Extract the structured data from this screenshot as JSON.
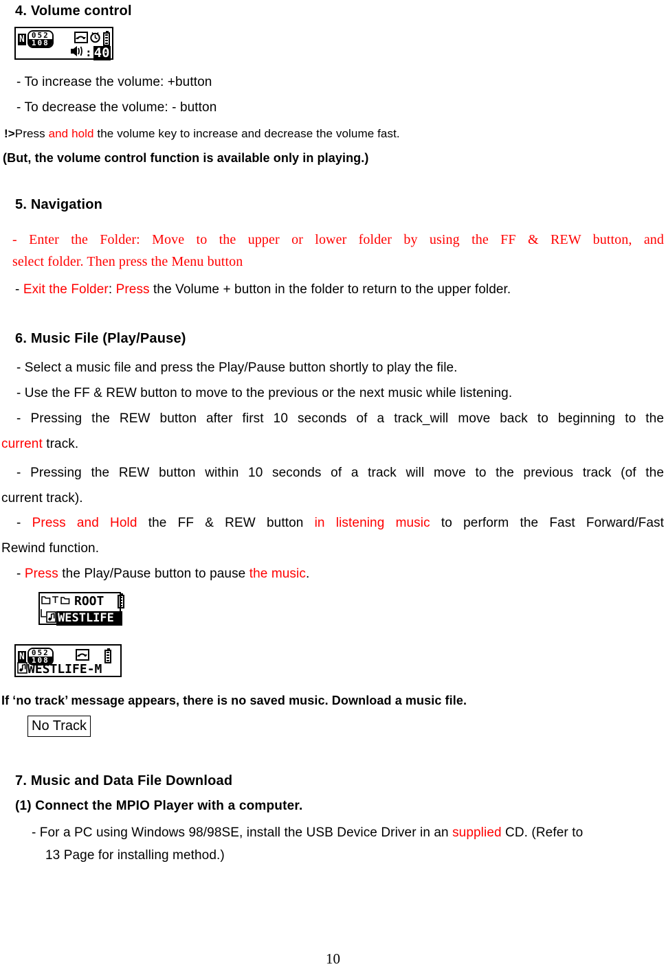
{
  "document": {
    "page_number": "10"
  },
  "sections": {
    "volume": {
      "heading": "4. Volume control",
      "bullet_increase": "-  To increase the volume: +button",
      "bullet_decrease": "-  To decrease the volume: - button",
      "note_prefix": "!>",
      "note_a": "Press ",
      "note_highlight": "and hold",
      "note_b": " the volume key to increase and decrease the volume fast.",
      "note_paren": "(But, the volume control function is available only in playing.)",
      "lcd": {
        "name": "volume-lcd",
        "indicator_letter": "N",
        "track_current": "052",
        "track_total": "108",
        "icon_repeat": "repeat-folder-icon",
        "icon_clock": "clock-icon",
        "icon_battery": "battery-icon",
        "volume_label": ":",
        "volume_value": "40"
      }
    },
    "navigation": {
      "heading": "5. Navigation",
      "enter_line1": "-  Enter the Folder: Move to the upper or lower folder by using the FF & REW button, and",
      "enter_line2": "select folder. Then press the Menu button",
      "exit_dash": "-  ",
      "exit_red1": "Exit the Folder",
      "exit_black1": ": ",
      "exit_red2": "Press",
      "exit_black2": " the Volume + button in the folder to return to the upper folder."
    },
    "musicfile": {
      "heading": "6. Music File (Play/Pause)",
      "b1": "-  Select a music file and press the Play/Pause button shortly to play the file.",
      "b2": "-  Use the FF & REW button to move to the previous or the next music while listening.",
      "b3_line1": "-  Pressing the REW button after first 10 seconds of a track_will move back to beginning to the",
      "b3_line2_red": "current",
      "b3_line2_black": " track.",
      "b4_line1": "-  Pressing the REW button within 10 seconds of a track will move to the previous track (of the",
      "b4_line2": "current track).",
      "b5_dash": "-  ",
      "b5_red1": "Press and Hold",
      "b5_black1": " the FF & REW button ",
      "b5_red2": "in listening music",
      "b5_black2": " to perform the Fast Forward/Fast",
      "b5_line2": "Rewind function.",
      "b6_dash": "-  ",
      "b6_red1": "Press",
      "b6_black1": " the Play/Pause button to pause ",
      "b6_red2": "the music",
      "b6_black2": ".",
      "lcd_root": {
        "name": "folder-browse-lcd",
        "icon_folder": "folder-icon",
        "icon_tree": "tree-branch-icon",
        "icon_subfolder": "subfolder-icon",
        "title": "ROOT",
        "icon_battery": "battery-icon",
        "icon_music_file": "music-file-icon",
        "selected_item": "WESTLIFE"
      },
      "lcd_playing": {
        "name": "now-playing-lcd",
        "indicator_letter": "N",
        "track_current": "052",
        "track_total": "108",
        "icon_repeat": "repeat-folder-icon",
        "icon_battery": "battery-icon",
        "icon_music_file": "music-file-icon",
        "track_title": "WESTLIFE-M"
      },
      "notrack_text": "If ‘no track’ message appears, there is no saved music. Download a music file.",
      "notrack_box_label": "No Track"
    },
    "download": {
      "heading": "7. Music and Data File Download",
      "step1": "(1) Connect the MPIO Player with a computer.",
      "step1_sub_a": "-  For a PC using Windows 98/98SE, install the USB Device Driver in an ",
      "step1_sub_red": "supplied",
      "step1_sub_b": " CD. (Refer to",
      "step1_sub_line2": "13 Page for installing method.)"
    }
  },
  "colors": {
    "accent_red": "#ff0000",
    "text": "#000000",
    "background": "#ffffff"
  }
}
